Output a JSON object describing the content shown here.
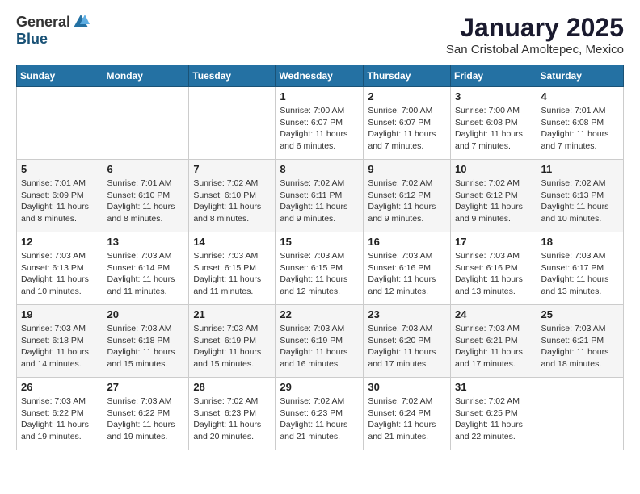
{
  "logo": {
    "general": "General",
    "blue": "Blue"
  },
  "header": {
    "month": "January 2025",
    "location": "San Cristobal Amoltepec, Mexico"
  },
  "weekdays": [
    "Sunday",
    "Monday",
    "Tuesday",
    "Wednesday",
    "Thursday",
    "Friday",
    "Saturday"
  ],
  "weeks": [
    [
      {
        "day": "",
        "info": ""
      },
      {
        "day": "",
        "info": ""
      },
      {
        "day": "",
        "info": ""
      },
      {
        "day": "1",
        "info": "Sunrise: 7:00 AM\nSunset: 6:07 PM\nDaylight: 11 hours\nand 6 minutes."
      },
      {
        "day": "2",
        "info": "Sunrise: 7:00 AM\nSunset: 6:07 PM\nDaylight: 11 hours\nand 7 minutes."
      },
      {
        "day": "3",
        "info": "Sunrise: 7:00 AM\nSunset: 6:08 PM\nDaylight: 11 hours\nand 7 minutes."
      },
      {
        "day": "4",
        "info": "Sunrise: 7:01 AM\nSunset: 6:08 PM\nDaylight: 11 hours\nand 7 minutes."
      }
    ],
    [
      {
        "day": "5",
        "info": "Sunrise: 7:01 AM\nSunset: 6:09 PM\nDaylight: 11 hours\nand 8 minutes."
      },
      {
        "day": "6",
        "info": "Sunrise: 7:01 AM\nSunset: 6:10 PM\nDaylight: 11 hours\nand 8 minutes."
      },
      {
        "day": "7",
        "info": "Sunrise: 7:02 AM\nSunset: 6:10 PM\nDaylight: 11 hours\nand 8 minutes."
      },
      {
        "day": "8",
        "info": "Sunrise: 7:02 AM\nSunset: 6:11 PM\nDaylight: 11 hours\nand 9 minutes."
      },
      {
        "day": "9",
        "info": "Sunrise: 7:02 AM\nSunset: 6:12 PM\nDaylight: 11 hours\nand 9 minutes."
      },
      {
        "day": "10",
        "info": "Sunrise: 7:02 AM\nSunset: 6:12 PM\nDaylight: 11 hours\nand 9 minutes."
      },
      {
        "day": "11",
        "info": "Sunrise: 7:02 AM\nSunset: 6:13 PM\nDaylight: 11 hours\nand 10 minutes."
      }
    ],
    [
      {
        "day": "12",
        "info": "Sunrise: 7:03 AM\nSunset: 6:13 PM\nDaylight: 11 hours\nand 10 minutes."
      },
      {
        "day": "13",
        "info": "Sunrise: 7:03 AM\nSunset: 6:14 PM\nDaylight: 11 hours\nand 11 minutes."
      },
      {
        "day": "14",
        "info": "Sunrise: 7:03 AM\nSunset: 6:15 PM\nDaylight: 11 hours\nand 11 minutes."
      },
      {
        "day": "15",
        "info": "Sunrise: 7:03 AM\nSunset: 6:15 PM\nDaylight: 11 hours\nand 12 minutes."
      },
      {
        "day": "16",
        "info": "Sunrise: 7:03 AM\nSunset: 6:16 PM\nDaylight: 11 hours\nand 12 minutes."
      },
      {
        "day": "17",
        "info": "Sunrise: 7:03 AM\nSunset: 6:16 PM\nDaylight: 11 hours\nand 13 minutes."
      },
      {
        "day": "18",
        "info": "Sunrise: 7:03 AM\nSunset: 6:17 PM\nDaylight: 11 hours\nand 13 minutes."
      }
    ],
    [
      {
        "day": "19",
        "info": "Sunrise: 7:03 AM\nSunset: 6:18 PM\nDaylight: 11 hours\nand 14 minutes."
      },
      {
        "day": "20",
        "info": "Sunrise: 7:03 AM\nSunset: 6:18 PM\nDaylight: 11 hours\nand 15 minutes."
      },
      {
        "day": "21",
        "info": "Sunrise: 7:03 AM\nSunset: 6:19 PM\nDaylight: 11 hours\nand 15 minutes."
      },
      {
        "day": "22",
        "info": "Sunrise: 7:03 AM\nSunset: 6:19 PM\nDaylight: 11 hours\nand 16 minutes."
      },
      {
        "day": "23",
        "info": "Sunrise: 7:03 AM\nSunset: 6:20 PM\nDaylight: 11 hours\nand 17 minutes."
      },
      {
        "day": "24",
        "info": "Sunrise: 7:03 AM\nSunset: 6:21 PM\nDaylight: 11 hours\nand 17 minutes."
      },
      {
        "day": "25",
        "info": "Sunrise: 7:03 AM\nSunset: 6:21 PM\nDaylight: 11 hours\nand 18 minutes."
      }
    ],
    [
      {
        "day": "26",
        "info": "Sunrise: 7:03 AM\nSunset: 6:22 PM\nDaylight: 11 hours\nand 19 minutes."
      },
      {
        "day": "27",
        "info": "Sunrise: 7:03 AM\nSunset: 6:22 PM\nDaylight: 11 hours\nand 19 minutes."
      },
      {
        "day": "28",
        "info": "Sunrise: 7:02 AM\nSunset: 6:23 PM\nDaylight: 11 hours\nand 20 minutes."
      },
      {
        "day": "29",
        "info": "Sunrise: 7:02 AM\nSunset: 6:23 PM\nDaylight: 11 hours\nand 21 minutes."
      },
      {
        "day": "30",
        "info": "Sunrise: 7:02 AM\nSunset: 6:24 PM\nDaylight: 11 hours\nand 21 minutes."
      },
      {
        "day": "31",
        "info": "Sunrise: 7:02 AM\nSunset: 6:25 PM\nDaylight: 11 hours\nand 22 minutes."
      },
      {
        "day": "",
        "info": ""
      }
    ]
  ]
}
